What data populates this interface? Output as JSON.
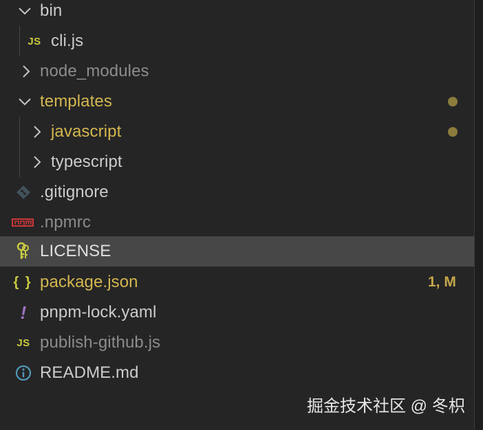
{
  "colors": {
    "background": "#252526",
    "selected_row": "#474748",
    "default_text": "#cccccc",
    "modified_text": "#d4b74e",
    "ignored_text": "#8c8c8c",
    "modified_dot": "#8c7c3b",
    "js_icon": "#cbcb41",
    "json_icon": "#cbcb41",
    "yaml_icon": "#a074c4",
    "info_icon": "#519aba",
    "npm_icon": "#cb3837",
    "git_icon": "#41535b"
  },
  "tree": [
    {
      "label": "bin",
      "kind": "folder",
      "expanded": true,
      "icon": "chevron-down-icon",
      "status": "normal"
    },
    {
      "label": "cli.js",
      "kind": "file",
      "icon": "javascript-file-icon",
      "icon_text": "JS",
      "status": "normal"
    },
    {
      "label": "node_modules",
      "kind": "folder",
      "expanded": false,
      "icon": "chevron-right-icon",
      "status": "ignored"
    },
    {
      "label": "templates",
      "kind": "folder",
      "expanded": true,
      "icon": "chevron-down-icon",
      "status": "modified"
    },
    {
      "label": "javascript",
      "kind": "folder",
      "expanded": false,
      "icon": "chevron-right-icon",
      "status": "modified"
    },
    {
      "label": "typescript",
      "kind": "folder",
      "expanded": false,
      "icon": "chevron-right-icon",
      "status": "normal"
    },
    {
      "label": ".gitignore",
      "kind": "file",
      "icon": "git-icon",
      "status": "normal"
    },
    {
      "label": ".npmrc",
      "kind": "file",
      "icon": "npm-icon",
      "icon_text": "npm",
      "status": "ignored"
    },
    {
      "label": "LICENSE",
      "kind": "file",
      "icon": "key-icon",
      "status": "normal",
      "selected": true
    },
    {
      "label": "package.json",
      "kind": "file",
      "icon": "json-braces-icon",
      "icon_text": "{ }",
      "status": "modified",
      "badge": "1, M"
    },
    {
      "label": "pnpm-lock.yaml",
      "kind": "file",
      "icon": "yaml-exclamation-icon",
      "icon_text": "!",
      "status": "normal"
    },
    {
      "label": "publish-github.js",
      "kind": "file",
      "icon": "javascript-file-icon",
      "icon_text": "JS",
      "status": "ignored"
    },
    {
      "label": "README.md",
      "kind": "file",
      "icon": "info-icon",
      "icon_text": "i",
      "status": "normal"
    }
  ],
  "watermark": "掘金技术社区 @ 冬枳"
}
